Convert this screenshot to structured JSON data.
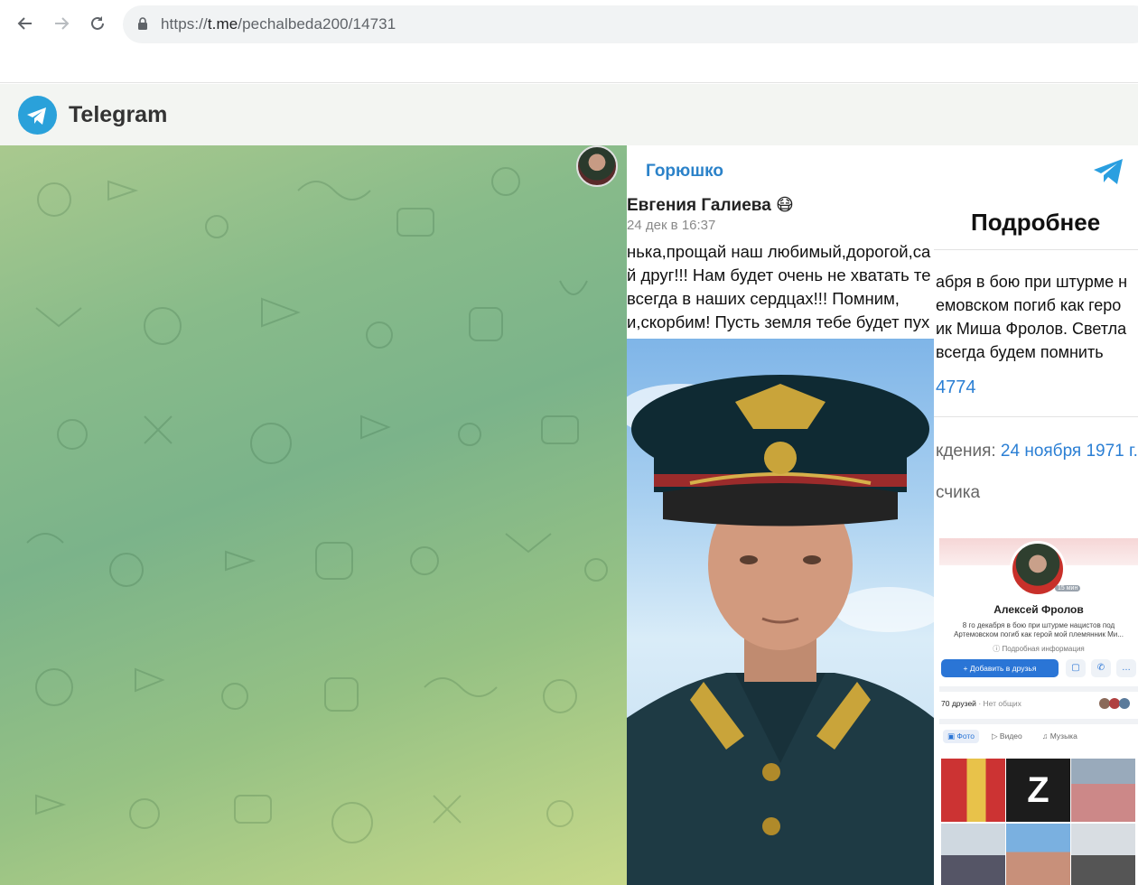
{
  "browser": {
    "url_scheme": "https://",
    "url_host": "t.me",
    "url_path": "/pechalbeda200/14731"
  },
  "telegram": {
    "app_title": "Telegram",
    "channel_name": "Горюшко"
  },
  "post_image": {
    "vk_post": {
      "author": "Евгения Галиева 😷",
      "date": "24 дек в 16:37",
      "text_lines": [
        "нька,прощай наш любимый,дорогой,са",
        "й друг!!! Нам будет очень не хватать те",
        "всегда в наших сердцах!!! Помним,",
        "и,скорбим! Пусть земля тебе будет пух"
      ]
    },
    "vk_profile": {
      "more_button": "Подробнее",
      "status_lines": [
        "абря в бою при штурме н",
        "емовском погиб как геро",
        "ик Миша Фролов. Светла",
        "всегда будем помнить"
      ],
      "link_number": "4774",
      "birth_label": "кдения:",
      "birth_value": "24 ноября 1971 г.",
      "job_label": "счика",
      "card": {
        "online_tag": "15 мин",
        "name": "Алексей Фролов",
        "status": "8 го декабря в бою при штурме нацистов под Артемовском погиб как герой мой племянник Ми...",
        "info_link": "Подробная информация",
        "add_friend": "Добавить в друзья",
        "friends_count": "70 друзей",
        "friends_mutual": "· Нет общих",
        "tabs": [
          "Фото",
          "Видео",
          "Музыка"
        ]
      }
    }
  },
  "colors": {
    "telegram_blue": "#2aa1da",
    "link_blue": "#2b82c9",
    "vk_blue": "#2a75d6"
  }
}
